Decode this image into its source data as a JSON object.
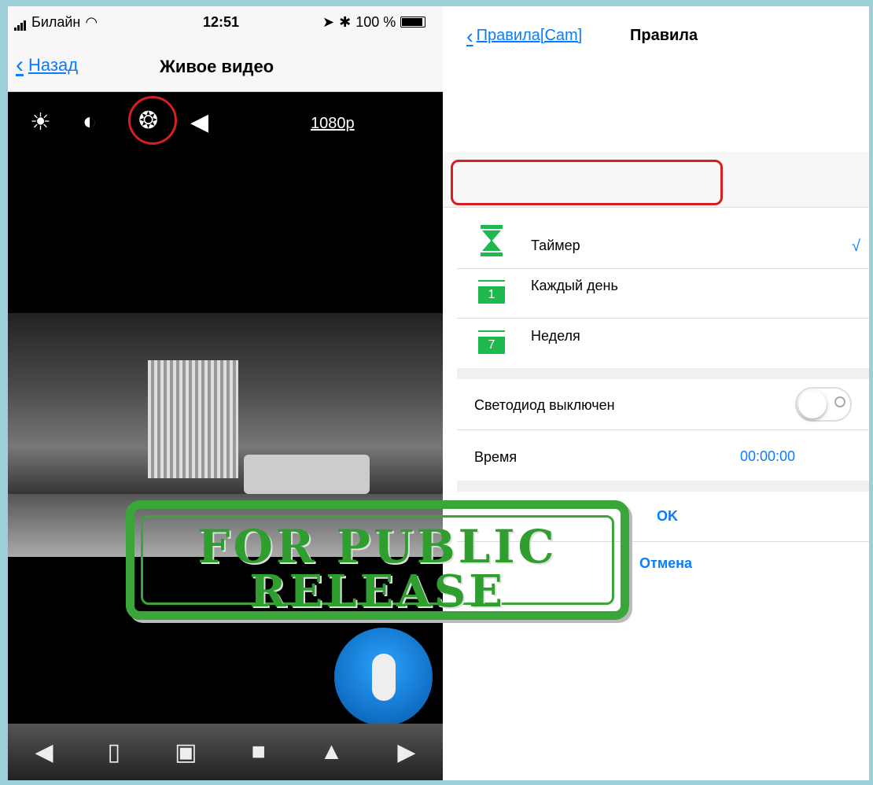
{
  "status_bar": {
    "carrier": "Билайн",
    "time": "12:51",
    "battery": "100 %"
  },
  "left_nav": {
    "back_label": "Назад",
    "title": "Живое видео"
  },
  "video_toolbar": {
    "resolution": "1080p",
    "icons": [
      "brightness-icon",
      "contrast-icon",
      "night-light-icon",
      "speaker-light-icon"
    ]
  },
  "bottom_toolbar": {
    "icons": [
      "mute-icon",
      "mic-icon",
      "snapshot-icon",
      "record-icon",
      "flip-icon",
      "mirror-icon"
    ]
  },
  "rules_nav": {
    "back_label": "Правила[Cam]",
    "title": "Правила"
  },
  "schedule_options": [
    {
      "label": "Таймер",
      "selected": true,
      "icon": "timer-icon"
    },
    {
      "label": "Каждый день",
      "selected": false,
      "icon": "calendar-1-icon",
      "badge": "1"
    },
    {
      "label": "Неделя",
      "selected": false,
      "icon": "calendar-7-icon",
      "badge": "7"
    }
  ],
  "check_mark": "√",
  "led_row": {
    "label": "Светодиод выключен",
    "toggle_on": false
  },
  "time_row": {
    "label": "Время",
    "value": "00:00:00"
  },
  "actions": {
    "ok": "OK",
    "cancel": "Отмена"
  },
  "stamp": {
    "line1": "FOR PUBLIC",
    "line2": "RELEASE"
  },
  "colors": {
    "accent": "#0a7cff",
    "highlight": "#d62020",
    "stamp": "#3aa53a",
    "icon_green": "#1fb84f"
  }
}
